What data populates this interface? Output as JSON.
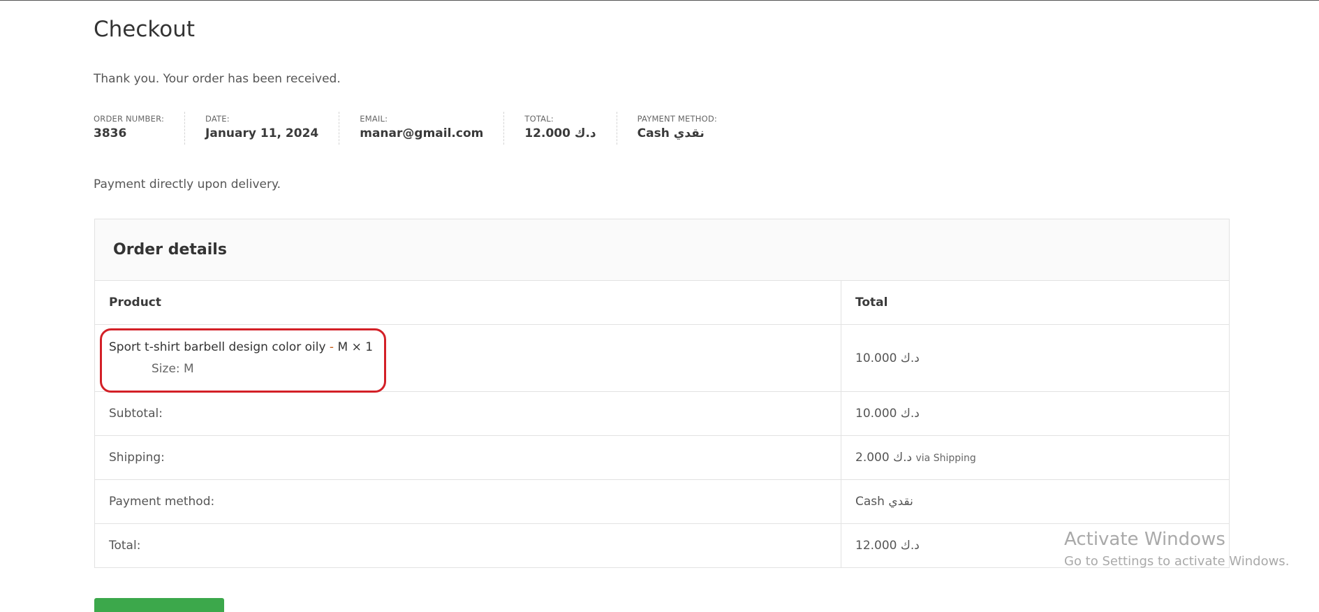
{
  "page": {
    "title": "Checkout"
  },
  "order": {
    "thankyou": "Thank you. Your order has been received.",
    "overview": [
      {
        "label": "ORDER NUMBER:",
        "value": "3836"
      },
      {
        "label": "DATE:",
        "value": "January 11, 2024"
      },
      {
        "label": "EMAIL:",
        "value": "manar@gmail.com"
      },
      {
        "label": "TOTAL:",
        "value": "د.ك 12.000"
      },
      {
        "label": "PAYMENT METHOD:",
        "value": "Cash نقدي"
      }
    ],
    "payment_note": "Payment directly upon delivery."
  },
  "details": {
    "title": "Order details",
    "columns": {
      "product": "Product",
      "total": "Total"
    },
    "item": {
      "name": "Sport t-shirt barbell design color oily",
      "separator": " - ",
      "variant": "M",
      "qty": "× 1",
      "meta_label": "Size:",
      "meta_value": "M",
      "total": "10.000 د.ك"
    },
    "rows": [
      {
        "label": "Subtotal:",
        "value": "10.000 د.ك",
        "note": ""
      },
      {
        "label": "Shipping:",
        "value": "2.000 د.ك",
        "note": "via Shipping"
      },
      {
        "label": "Payment method:",
        "value": "Cash نقدي",
        "note": ""
      },
      {
        "label": "Total:",
        "value": "12.000 د.ك",
        "note": ""
      }
    ]
  },
  "watermark": {
    "title": "Activate Windows",
    "subtitle": "Go to Settings to activate Windows."
  },
  "colors": {
    "highlight": "#d32027",
    "button": "#3ca84b",
    "accent_separator": "#c45a14"
  }
}
